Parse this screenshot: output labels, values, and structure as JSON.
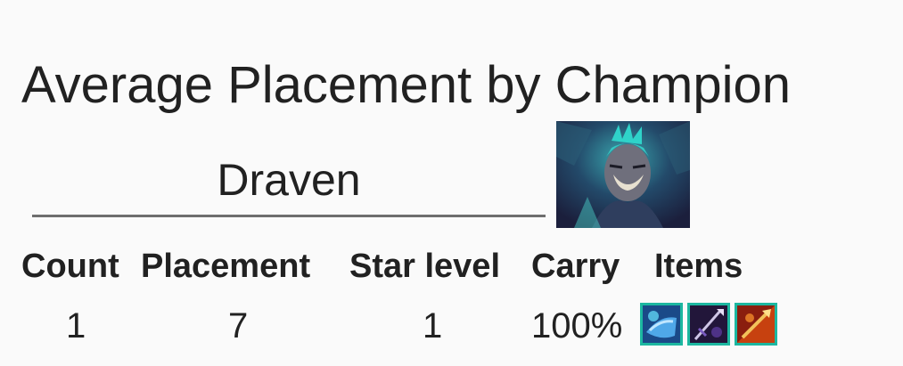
{
  "page": {
    "title": "Average Placement by Champion"
  },
  "champion": {
    "selected": "Draven",
    "portrait_icon": "draven-portrait-icon"
  },
  "table": {
    "headers": [
      "Count",
      "Placement",
      "Star level",
      "Carry",
      "Items"
    ],
    "rows": [
      {
        "count": "1",
        "placement": "7",
        "star_level": "1",
        "carry": "100%",
        "items": [
          "item-icon-blue-shield",
          "item-icon-purple-spear",
          "item-icon-fire-spear"
        ]
      }
    ]
  },
  "colors": {
    "background": "#fafafa",
    "text": "#212121",
    "underline": "#6e6e6e",
    "item_border": "#1cb7a0"
  }
}
